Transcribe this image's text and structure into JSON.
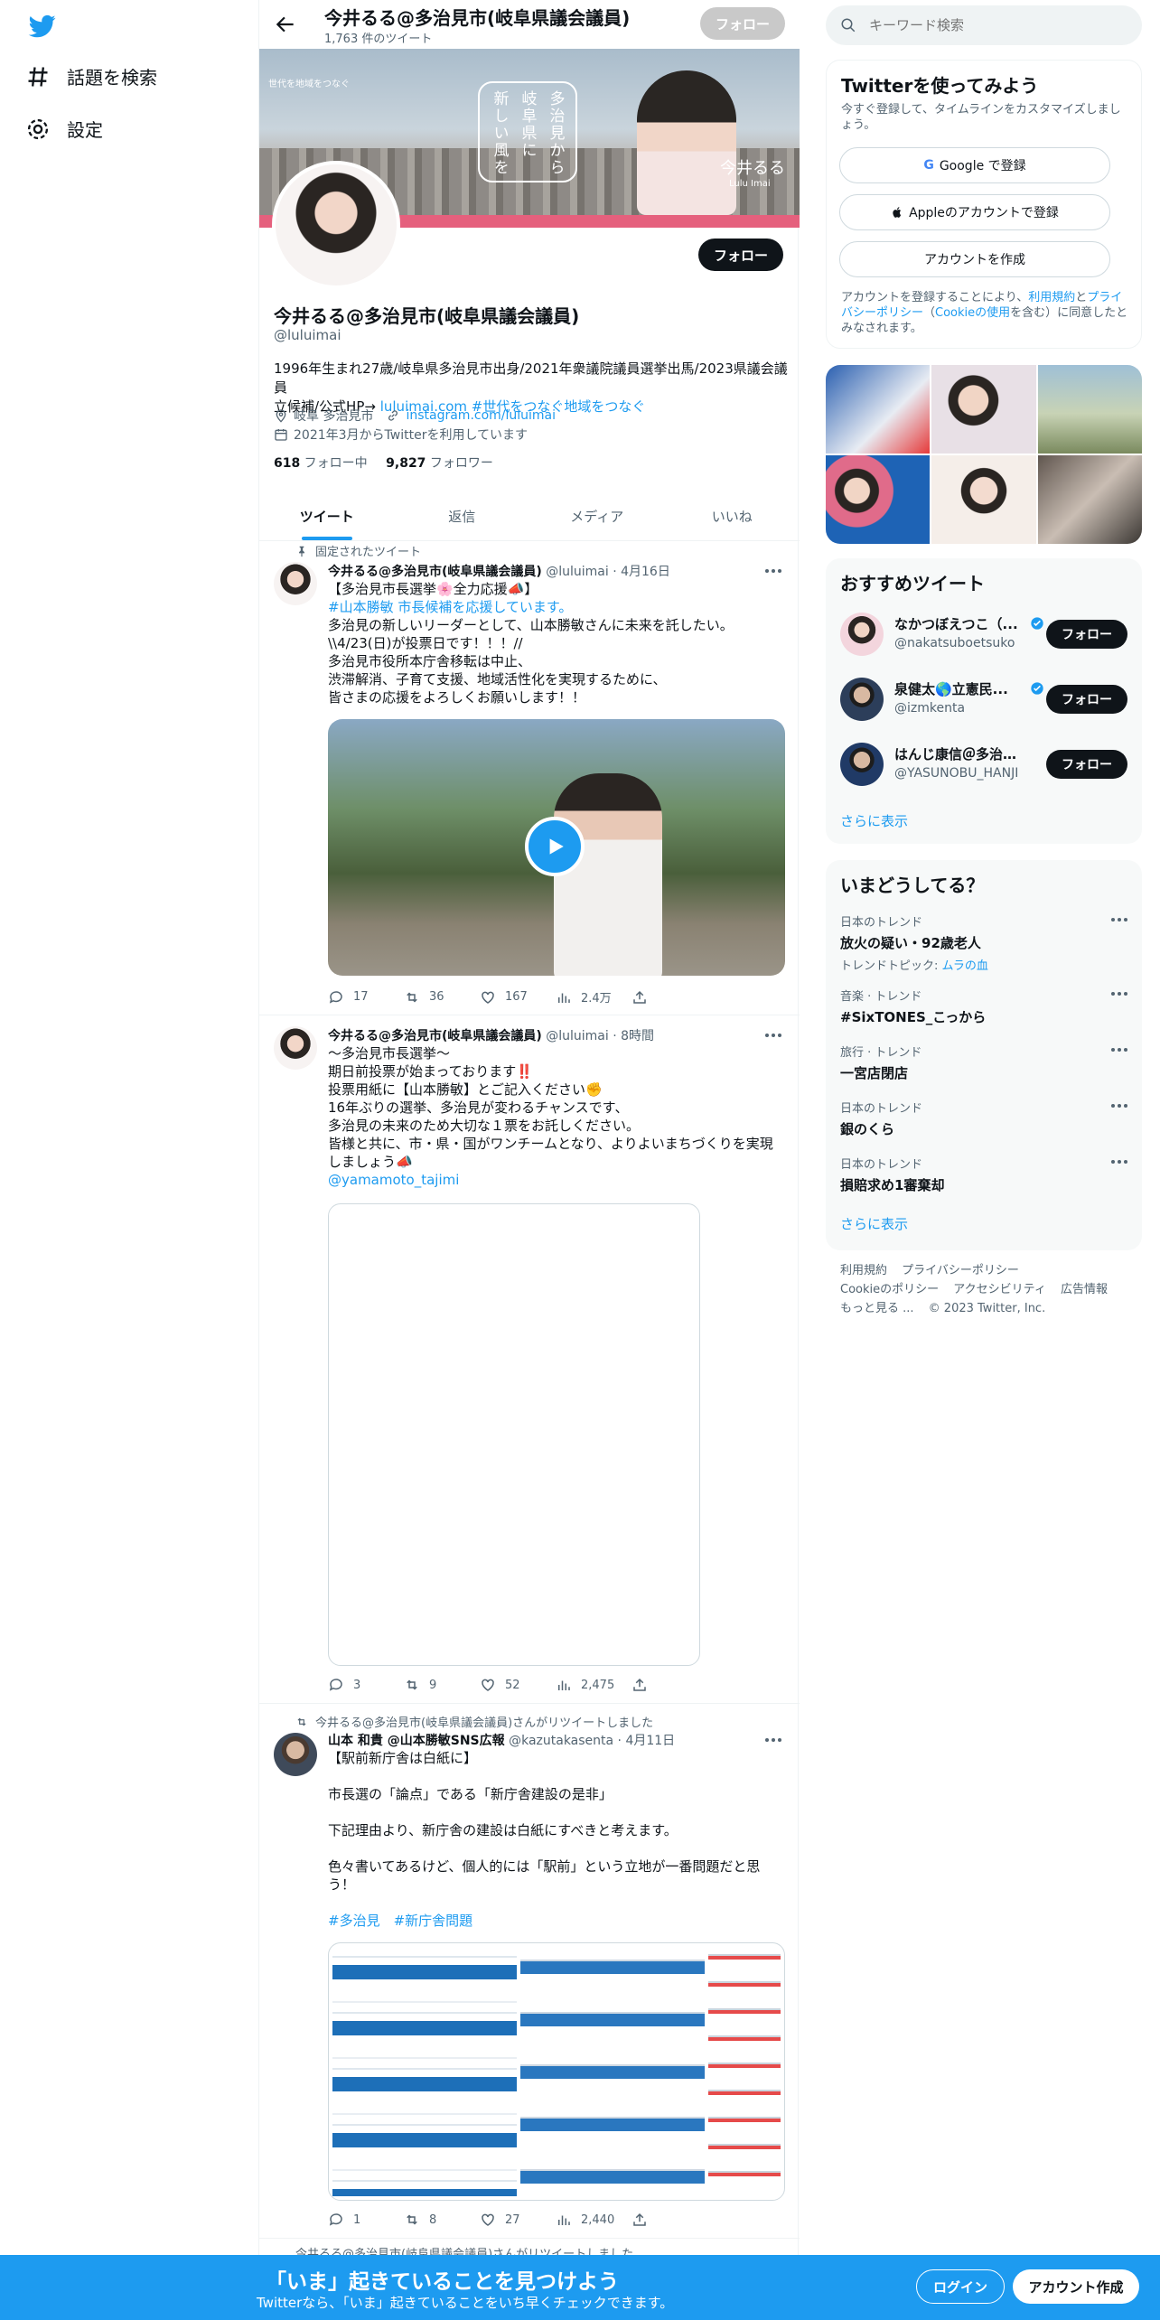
{
  "nav": {
    "explore": "話題を検索",
    "settings": "設定"
  },
  "profile_header": {
    "title": "今井るる@多治見市(岐阜県議会議員)",
    "tweet_count": "1,763 件のツイート",
    "follow": "フォロー"
  },
  "banner": {
    "slogan": "世代を地域をつなぐ",
    "vertical_1": "多治見から",
    "vertical_2": "岐阜県に",
    "vertical_3": "新しい風を",
    "name": "今井るる",
    "name_roman": "Lulu Imai"
  },
  "profile": {
    "name": "今井るる@多治見市(岐阜県議会議員)",
    "handle": "@luluimai",
    "follow": "フォロー",
    "bio_line1": "1996年生まれ27歳/岐阜県多治見市出身/2021年衆議院議員選挙出馬/2023県議会議員",
    "bio_line2_text": "立候補/公式HP→ ",
    "bio_link": "luluimai.com",
    "bio_hashtag": " #世代をつなぐ地域をつなぐ",
    "location": "岐阜 多治見市",
    "website": "instagram.com/luluimai",
    "joined": "2021年3月からTwitterを利用しています",
    "following_count": "618",
    "following_label": " フォロー中",
    "followers_count": "9,827",
    "followers_label": " フォロワー"
  },
  "tabs": [
    "ツイート",
    "返信",
    "メディア",
    "いいね"
  ],
  "tweets": [
    {
      "pre": "固定されたツイート",
      "name": "今井るる@多治見市(岐阜県議会議員)",
      "handle_time": " @luluimai · 4月16日",
      "lines": [
        "【多治見市長選挙🌸全力応援📣】",
        "#山本勝敏 市長候補を応援しています。",
        "多治見の新しいリーダーとして、山本勝敏さんに未来を託したい。",
        "\\\\4/23(日)が投票日です！！！//",
        "多治見市役所本庁舎移転は中止、",
        "渋滞解消、子育て支援、地域活性化を実現するために、",
        "皆さまの応援をよろしくお願いします！！"
      ],
      "replies": "17",
      "retweets": "36",
      "likes": "167",
      "views": "2.4万"
    },
    {
      "name": "今井るる@多治見市(岐阜県議会議員)",
      "handle_time": " @luluimai · 8時間",
      "lines": [
        "〜多治見市長選挙〜",
        "期日前投票が始まっております‼️",
        "投票用紙に【山本勝敏】とご記入ください✊",
        "16年ぶりの選挙、多治見が変わるチャンスです、",
        "多治見の未来のため大切な１票をお託しください。",
        "皆様と共に、市・県・国がワンチームとなり、よりよいまちづくりを実現",
        "しましょう📣"
      ],
      "mention": "@yamamoto_tajimi",
      "replies": "3",
      "retweets": "9",
      "likes": "52",
      "views": "2,475"
    },
    {
      "pre": "今井るる@多治見市(岐阜県議会議員)さんがリツイートしました",
      "name": "山本 和貴 @山本勝敏SNS広報",
      "handle_time": " @kazutakasenta · 4月11日",
      "lines": [
        "【駅前新庁舎は白紙に】",
        "",
        "市長選の「論点」である「新庁舎建設の是非」",
        "",
        "下記理由より、新庁舎の建設は白紙にすべきと考えます。",
        "",
        "色々書いてあるけど、個人的には「駅前」という立地が一番問題だと思",
        "う！",
        ""
      ],
      "hashtags": "#多治見　#新庁舎問題",
      "replies": "1",
      "retweets": "8",
      "likes": "27",
      "views": "2,440"
    }
  ],
  "next_tweet_pre": "今井るる@多治見市(岐阜県議会議員)さんがリツイートしました",
  "right": {
    "search_placeholder": "キーワード検索",
    "signup_title": "Twitterを使ってみよう",
    "signup_sub": "今すぐ登録して、タイムラインをカスタマイズしましょう。",
    "google": "Google で登録",
    "apple": "Appleのアカウントで登録",
    "create": "アカウントを作成",
    "legal_1": "アカウントを登録することにより、",
    "legal_terms": "利用規約",
    "legal_2": "と",
    "legal_privacy": "プライバシーポリシー",
    "legal_3": "（",
    "legal_cookie": "Cookieの使用",
    "legal_4": "を含む）に同意したとみなされます。",
    "recs_title": "おすすめツイート",
    "recs": [
      {
        "name": "なかつぼえつこ（...",
        "handle": "@nakatsuboetsuko",
        "btn": "フォロー",
        "verified": true
      },
      {
        "name": "泉健太🌎立憲民...",
        "handle": "@izmkenta",
        "btn": "フォロー",
        "verified": true
      },
      {
        "name": "はんじ康信＠多治見...",
        "handle": "@YASUNOBU_HANJI",
        "btn": "フォロー",
        "verified": false
      }
    ],
    "recs_more": "さらに表示",
    "trends_title": "いまどうしてる？",
    "trends": [
      {
        "ctx": "日本のトレンド",
        "name": "放火の疑い・92歳老人",
        "sub_label": "トレンドトピック: ",
        "sub_link": "ムラの血"
      },
      {
        "ctx": "音楽 · トレンド",
        "name": "#SixTONES_こっから"
      },
      {
        "ctx": "旅行 · トレンド",
        "name": "一宮店閉店"
      },
      {
        "ctx": "日本のトレンド",
        "name": "銀のくら"
      },
      {
        "ctx": "日本のトレンド",
        "name": "損賠求め1審棄却"
      }
    ],
    "trends_more": "さらに表示",
    "footer": [
      "利用規約",
      "プライバシーポリシー",
      "Cookieのポリシー",
      "アクセシビリティ",
      "広告情報",
      "もっと見る ...",
      "© 2023 Twitter, Inc."
    ]
  },
  "bottom": {
    "title": "「いま」起きていることを見つけよう",
    "sub": "Twitterなら、「いま」起きていることをいち早くチェックできます。",
    "login": "ログイン",
    "create": "アカウント作成"
  },
  "colors": {
    "accent": "#1d9bf0",
    "banner_pink": "#e5607d",
    "text": "#0f1419",
    "muted": "#536471"
  }
}
